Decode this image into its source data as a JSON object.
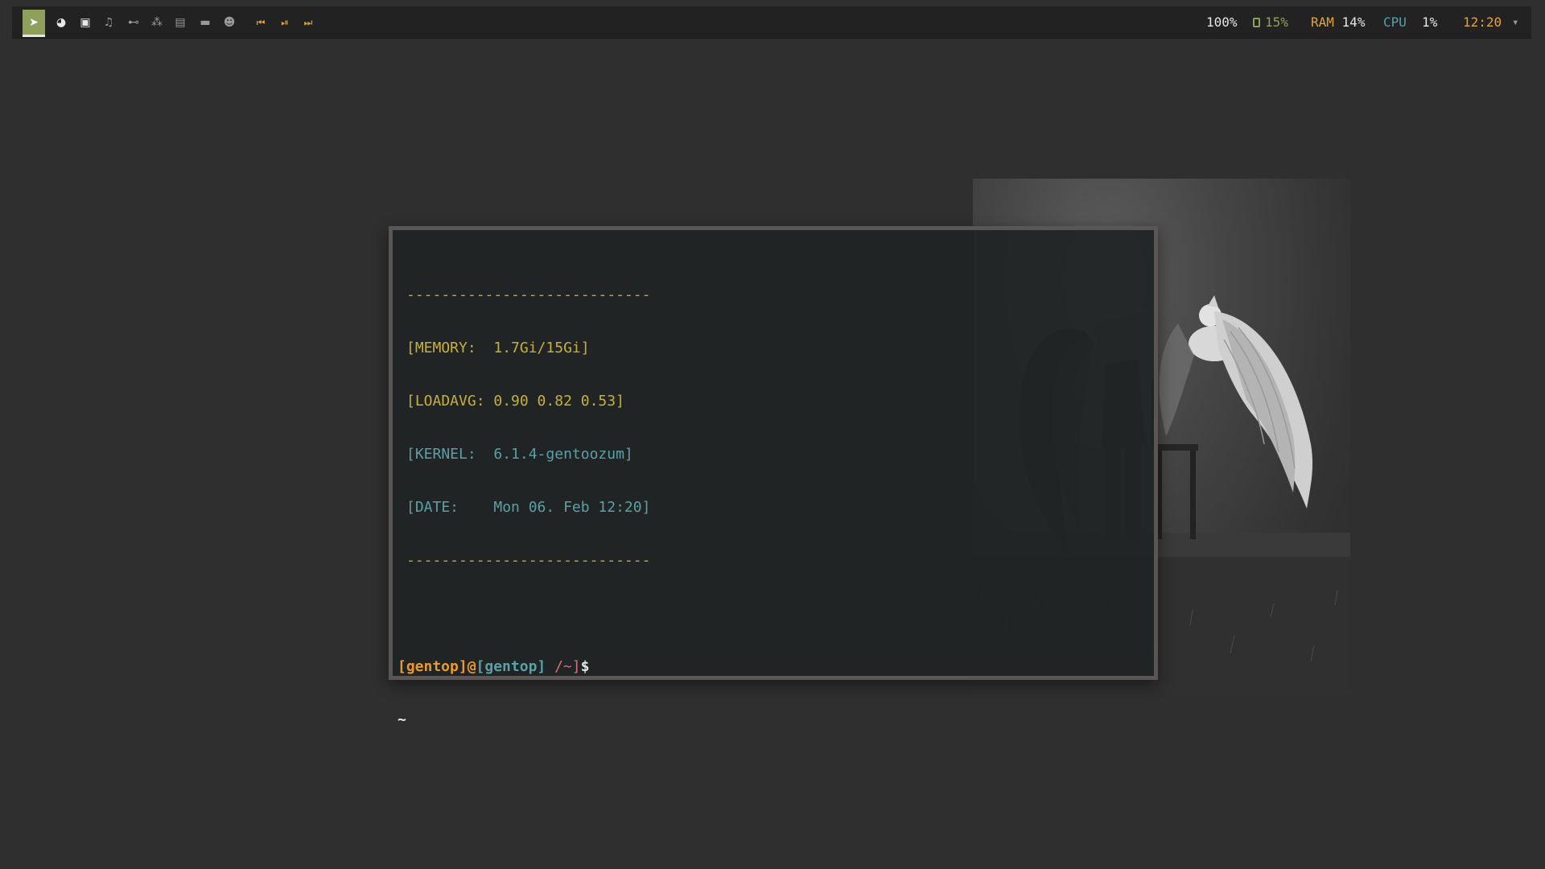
{
  "topbar": {
    "tags": [
      {
        "icon": "terminal-icon",
        "glyph": "➤",
        "active": true
      },
      {
        "icon": "firefox-icon",
        "glyph": "◕",
        "active": false
      },
      {
        "icon": "discord-icon",
        "glyph": "▣",
        "active": false
      },
      {
        "icon": "music-icon",
        "glyph": "♫",
        "active": false
      },
      {
        "icon": "gamepad-icon",
        "glyph": "⊷",
        "active": false
      },
      {
        "icon": "network-icon",
        "glyph": "⁂",
        "active": false
      },
      {
        "icon": "document-icon",
        "glyph": "▤",
        "active": false
      },
      {
        "icon": "folder-icon",
        "glyph": "▬",
        "active": false
      },
      {
        "icon": "alien-icon",
        "glyph": "☻",
        "active": false
      }
    ],
    "media": {
      "prev_icon": "skip-back-icon",
      "prev_glyph": "⏮",
      "play_icon": "play-pause-icon",
      "play_glyph": "⏯",
      "next_icon": "skip-forward-icon",
      "next_glyph": "⏭"
    },
    "status": {
      "volume": "100%",
      "storage_icon": "disk-icon",
      "storage": "15%",
      "ram_label": "RAM",
      "ram_value": "14%",
      "cpu_label": "CPU",
      "cpu_value": "1%",
      "clock": "12:20",
      "menu_icon": "chevron-down-icon",
      "menu_glyph": "▾"
    },
    "colors": {
      "active_tag": "#8fa05c",
      "volume": "#e6e6e6",
      "storage": "#8fa05c",
      "ram_label": "#e0a43a",
      "cpu_label": "#5aa0a6",
      "clock": "#e0a43a"
    }
  },
  "terminal": {
    "divider": "----------------------------",
    "memory": "[MEMORY:  1.7Gi/15Gi]",
    "loadavg": "[LOADAVG: 0.90 0.82 0.53]",
    "kernel": "[KERNEL:  6.1.4-gentoozum]",
    "date": "[DATE:    Mon 06. Feb 12:20]",
    "prompt": {
      "user": "[gentop]",
      "at": "@",
      "host": "[gentop]",
      "path": " /~]",
      "symbol": "$"
    },
    "tilde": "~"
  }
}
